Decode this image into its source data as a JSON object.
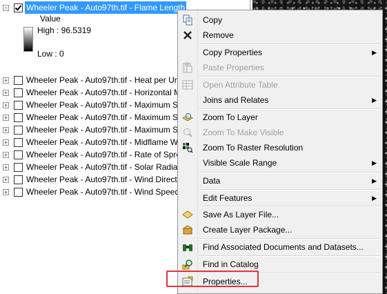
{
  "toc": {
    "selected_layer": "Wheeler Peak - Auto97th.tif - Flame Length",
    "legend": {
      "value_label": "Value",
      "high_label": "High : 96.5319",
      "low_label": "Low : 0"
    },
    "layers": [
      "Wheeler Peak - Auto97th.tif - Heat per Un",
      "Wheeler Peak - Auto97th.tif - Horizontal M",
      "Wheeler Peak - Auto97th.tif - Maximum S",
      "Wheeler Peak - Auto97th.tif - Maximum S",
      "Wheeler Peak - Auto97th.tif - Maximum S",
      "Wheeler Peak - Auto97th.tif - Midflame W",
      "Wheeler Peak - Auto97th.tif - Rate of Spre",
      "Wheeler Peak - Auto97th.tif - Solar Radiat",
      "Wheeler Peak - Auto97th.tif - Wind Direct",
      "Wheeler Peak - Auto97th.tif - Wind Speed"
    ]
  },
  "menu": {
    "copy": "Copy",
    "remove": "Remove",
    "copy_properties": "Copy Properties",
    "paste_properties": "Paste Properties",
    "open_attribute_table": "Open Attribute Table",
    "joins_and_relates": "Joins and Relates",
    "zoom_to_layer": "Zoom To Layer",
    "zoom_to_make_visible": "Zoom To Make Visible",
    "zoom_to_raster_resolution": "Zoom To Raster Resolution",
    "visible_scale_range": "Visible Scale Range",
    "data": "Data",
    "edit_features": "Edit Features",
    "save_as_layer_file": "Save As Layer File...",
    "create_layer_package": "Create Layer Package...",
    "find_associated_documents": "Find Associated Documents and Datasets...",
    "find_in_catalog": "Find in Catalog",
    "properties": "Properties..."
  },
  "colors": {
    "selection": "#3399ff",
    "highlight": "#e03434"
  }
}
